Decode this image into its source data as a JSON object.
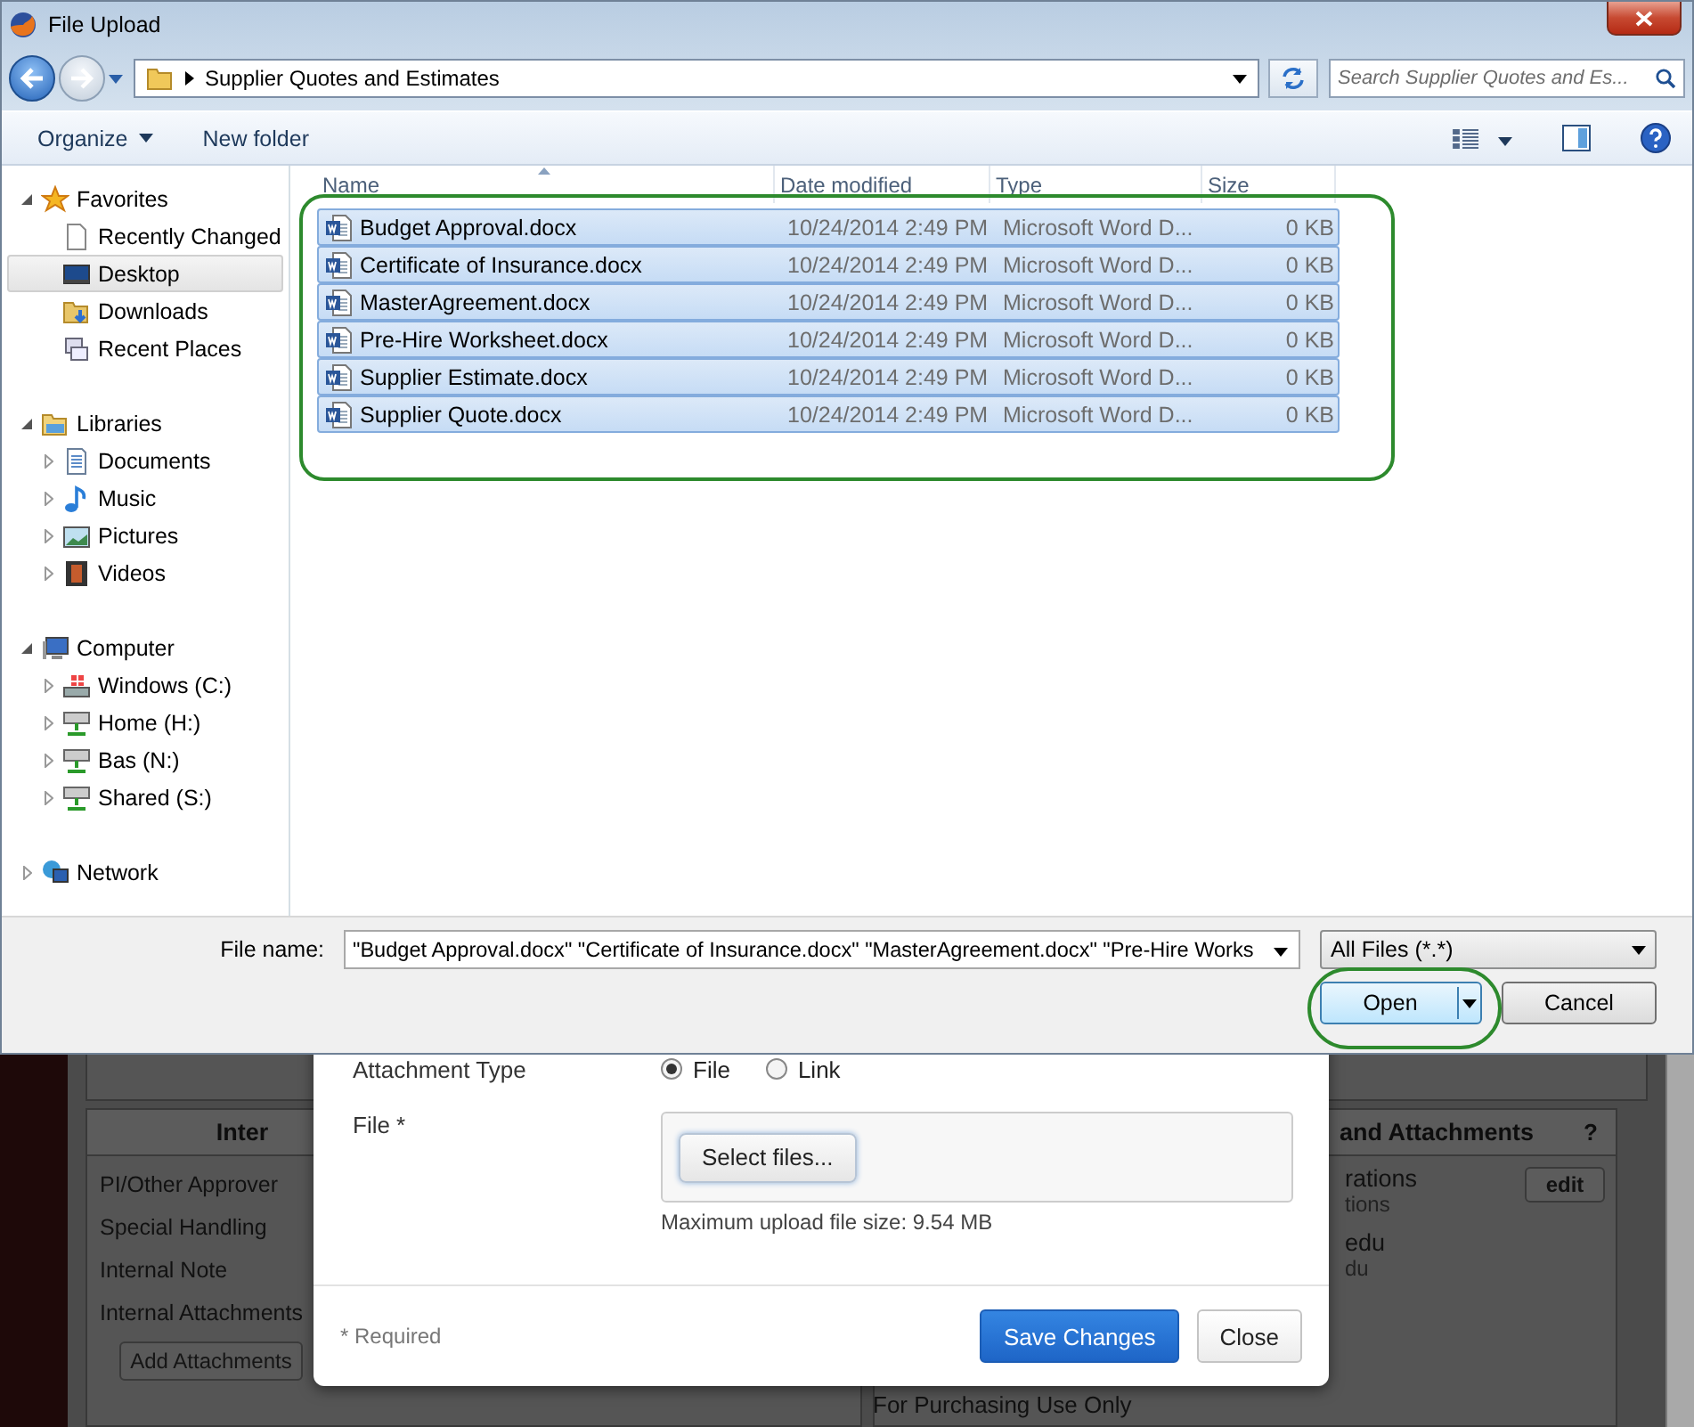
{
  "window": {
    "title": "File Upload"
  },
  "address": {
    "path": "Supplier Quotes and Estimates"
  },
  "search": {
    "placeholder": "Search Supplier Quotes and Es..."
  },
  "toolbar": {
    "organize": "Organize",
    "new_folder": "New folder"
  },
  "nav": [
    {
      "label": "Favorites",
      "kind": "favorites",
      "expanded": true,
      "selected": false,
      "children": [
        {
          "label": "Recently Changed",
          "kind": "page",
          "selected": false
        },
        {
          "label": "Desktop",
          "kind": "desktop",
          "selected": true
        },
        {
          "label": "Downloads",
          "kind": "downloads",
          "selected": false
        },
        {
          "label": "Recent Places",
          "kind": "recent",
          "selected": false
        }
      ]
    },
    {
      "label": "Libraries",
      "kind": "library",
      "expanded": true,
      "selected": false,
      "children": [
        {
          "label": "Documents",
          "kind": "documents",
          "expanded": false,
          "selected": false
        },
        {
          "label": "Music",
          "kind": "music",
          "expanded": false,
          "selected": false
        },
        {
          "label": "Pictures",
          "kind": "pictures",
          "expanded": false,
          "selected": false
        },
        {
          "label": "Videos",
          "kind": "videos",
          "expanded": false,
          "selected": false
        }
      ]
    },
    {
      "label": "Computer",
      "kind": "computer",
      "expanded": true,
      "selected": false,
      "children": [
        {
          "label": "Windows (C:)",
          "kind": "system-drive",
          "expanded": false,
          "selected": false
        },
        {
          "label": "Home (H:)",
          "kind": "network-drive",
          "expanded": false,
          "selected": false
        },
        {
          "label": "Bas (N:)",
          "kind": "network-drive",
          "expanded": false,
          "selected": false
        },
        {
          "label": "Shared (S:)",
          "kind": "network-drive",
          "expanded": false,
          "selected": false
        }
      ]
    },
    {
      "label": "Network",
      "kind": "network",
      "expanded": false,
      "selected": false
    }
  ],
  "files": {
    "columns": [
      "Name",
      "Date modified",
      "Type",
      "Size"
    ],
    "rows": [
      {
        "name": "Budget Approval.docx",
        "date": "10/24/2014 2:49 PM",
        "type": "Microsoft Word D...",
        "size": "0 KB",
        "selected": true
      },
      {
        "name": "Certificate of Insurance.docx",
        "date": "10/24/2014 2:49 PM",
        "type": "Microsoft Word D...",
        "size": "0 KB",
        "selected": true
      },
      {
        "name": "MasterAgreement.docx",
        "date": "10/24/2014 2:49 PM",
        "type": "Microsoft Word D...",
        "size": "0 KB",
        "selected": true
      },
      {
        "name": "Pre-Hire Worksheet.docx",
        "date": "10/24/2014 2:49 PM",
        "type": "Microsoft Word D...",
        "size": "0 KB",
        "selected": true
      },
      {
        "name": "Supplier Estimate.docx",
        "date": "10/24/2014 2:49 PM",
        "type": "Microsoft Word D...",
        "size": "0 KB",
        "selected": true
      },
      {
        "name": "Supplier Quote.docx",
        "date": "10/24/2014 2:49 PM",
        "type": "Microsoft Word D...",
        "size": "0 KB",
        "selected": true
      }
    ]
  },
  "file_name": {
    "label": "File name:",
    "value": "\"Budget Approval.docx\" \"Certificate of Insurance.docx\" \"MasterAgreement.docx\" \"Pre-Hire Works"
  },
  "filter": "All Files (*.*)",
  "buttons": {
    "open": "Open",
    "cancel": "Cancel"
  },
  "background": {
    "left_panel": {
      "heading": "Inter",
      "rows": [
        "PI/Other Approver",
        "Special Handling",
        "Internal Note",
        "Internal Attachments"
      ],
      "button": "Add Attachments"
    },
    "right_panel": {
      "heading": "and Attachments",
      "help": "?",
      "edit": "edit",
      "lines": [
        {
          "text": "rations",
          "sub": "tions"
        },
        {
          "text": "edu",
          "sub": "du"
        }
      ],
      "footer": "For Purchasing Use Only"
    }
  },
  "modal": {
    "type_label": "Attachment Type",
    "radios": [
      {
        "label": "File",
        "selected": true
      },
      {
        "label": "Link",
        "selected": false
      }
    ],
    "file_label": "File *",
    "select_button": "Select files...",
    "hint": "Maximum upload file size: 9.54 MB",
    "required": "* Required",
    "save": "Save Changes",
    "close": "Close"
  }
}
